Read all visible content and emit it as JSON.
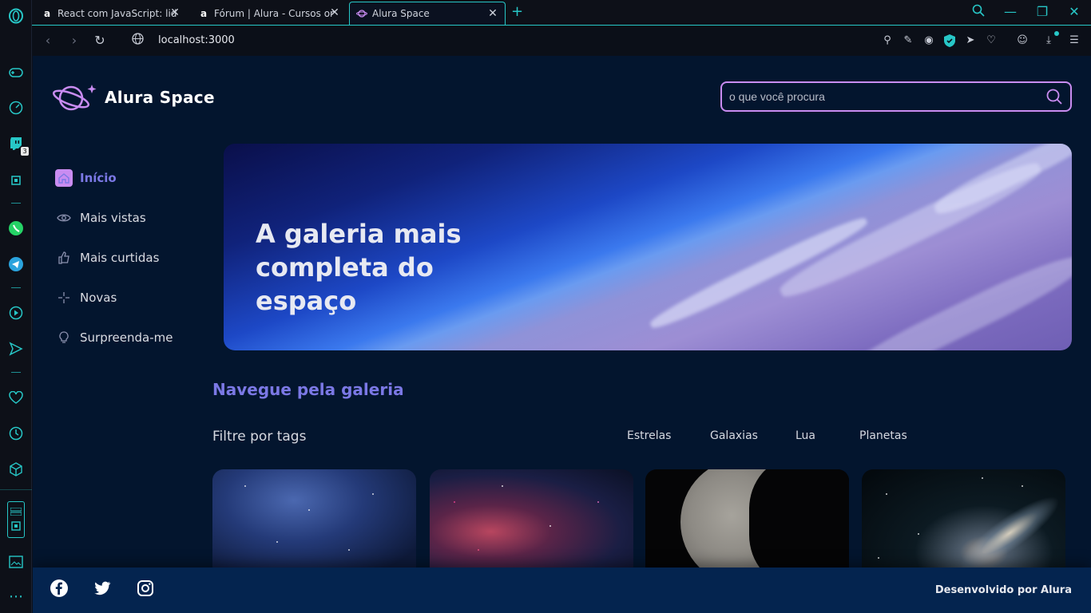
{
  "browser": {
    "tabs": [
      {
        "title": "React com JavaScript: lidan",
        "favicon": "a"
      },
      {
        "title": "Fórum | Alura - Cursos onli",
        "favicon": "a"
      },
      {
        "title": "Alura Space",
        "favicon": "planet"
      }
    ],
    "url": "localhost:3000",
    "sidebar_badge": "3"
  },
  "app": {
    "logo_text": "Alura Space",
    "search_placeholder": "o que você procura",
    "menu": [
      {
        "label": "Início",
        "icon": "home-icon",
        "active": true
      },
      {
        "label": "Mais vistas",
        "icon": "eye-icon",
        "active": false
      },
      {
        "label": "Mais curtidas",
        "icon": "thumbs-up-icon",
        "active": false
      },
      {
        "label": "Novas",
        "icon": "sparkle-icon",
        "active": false
      },
      {
        "label": "Surpreenda-me",
        "icon": "lightbulb-icon",
        "active": false
      }
    ],
    "banner_title": "A galeria mais completa do espaço",
    "section_title": "Navegue pela galeria",
    "filter_label": "Filtre por tags",
    "tags": [
      "Estrelas",
      "Galaxias",
      "Lua",
      "Planetas"
    ],
    "footer_credit": "Desenvolvido por Alura"
  },
  "colors": {
    "accent": "#c98cf1",
    "accent_text": "#7b78e5",
    "page_bg": "#03152e",
    "footer_bg": "#04244f",
    "browser_accent": "#27c7c7"
  }
}
